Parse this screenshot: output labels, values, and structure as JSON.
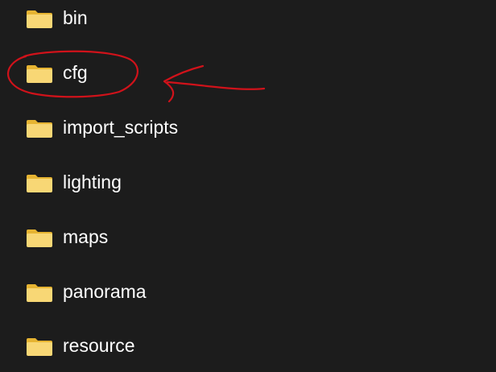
{
  "folders": [
    {
      "name": "bin",
      "icon": "folder-icon"
    },
    {
      "name": "cfg",
      "icon": "folder-icon"
    },
    {
      "name": "import_scripts",
      "icon": "folder-icon"
    },
    {
      "name": "lighting",
      "icon": "folder-icon"
    },
    {
      "name": "maps",
      "icon": "folder-icon"
    },
    {
      "name": "panorama",
      "icon": "folder-icon"
    },
    {
      "name": "resource",
      "icon": "folder-icon"
    }
  ],
  "colors": {
    "background": "#1c1c1c",
    "folder_body": "#f8d775",
    "folder_back": "#e6b432",
    "text": "#ffffff",
    "annotation": "#d0121a"
  }
}
